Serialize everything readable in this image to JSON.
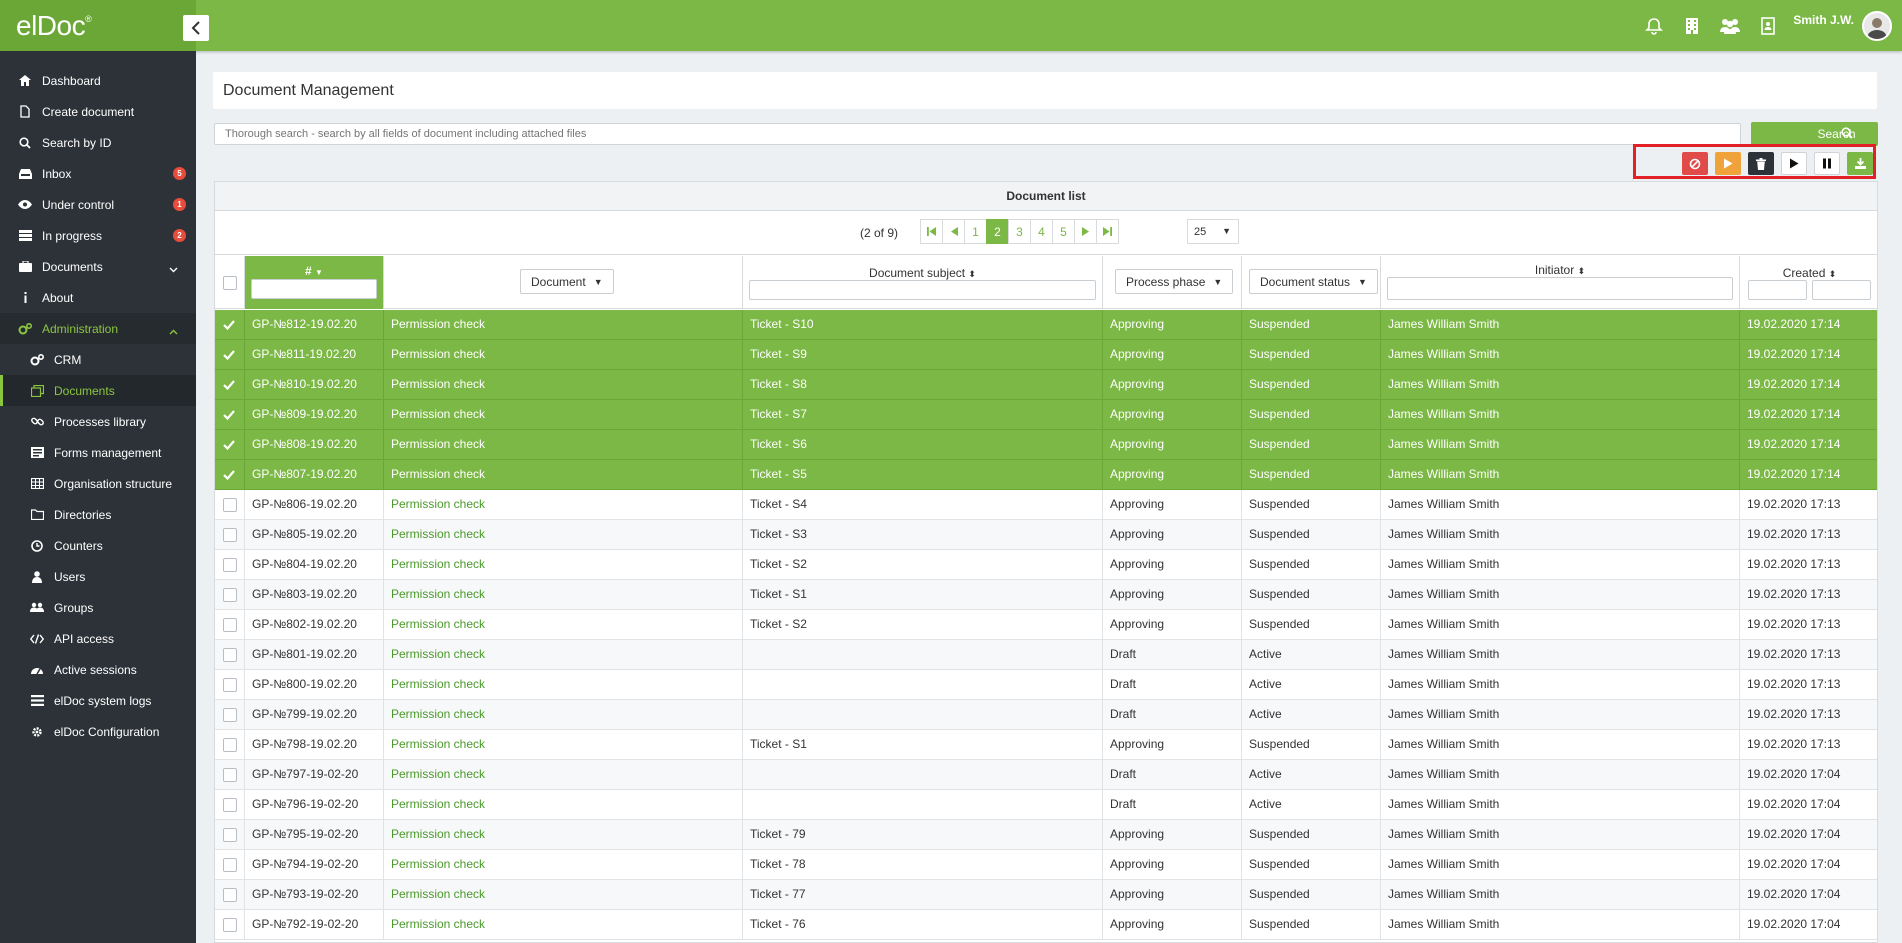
{
  "app": {
    "logo": "elDoc",
    "logo_mark": "®"
  },
  "topbar": {
    "icons": [
      "bell-icon",
      "building-icon",
      "users-icon",
      "book-icon"
    ],
    "user_name": "Smith J.W."
  },
  "sidebar": {
    "items": [
      {
        "label": "Dashboard",
        "icon": "home-icon"
      },
      {
        "label": "Create document",
        "icon": "file-icon"
      },
      {
        "label": "Search by ID",
        "icon": "search-icon"
      },
      {
        "label": "Inbox",
        "icon": "inbox-icon",
        "badge": "5"
      },
      {
        "label": "Under control",
        "icon": "eye-icon",
        "badge": "1"
      },
      {
        "label": "In progress",
        "icon": "progress-icon",
        "badge": "2"
      },
      {
        "label": "Documents",
        "icon": "briefcase-icon"
      },
      {
        "label": "About",
        "icon": "info-icon"
      },
      {
        "label": "Administration",
        "icon": "cogs-icon"
      }
    ],
    "sub_items": [
      {
        "label": "CRM",
        "icon": "cogs-icon"
      },
      {
        "label": "Documents",
        "icon": "documents-icon"
      },
      {
        "label": "Processes library",
        "icon": "link-icon"
      },
      {
        "label": "Forms management",
        "icon": "form-icon"
      },
      {
        "label": "Organisation structure",
        "icon": "table-icon"
      },
      {
        "label": "Directories",
        "icon": "folder-icon"
      },
      {
        "label": "Counters",
        "icon": "clock-icon"
      },
      {
        "label": "Users",
        "icon": "user-icon"
      },
      {
        "label": "Groups",
        "icon": "group-icon"
      },
      {
        "label": "API access",
        "icon": "code-icon"
      },
      {
        "label": "Active sessions",
        "icon": "dashboard-icon"
      },
      {
        "label": "elDoc system logs",
        "icon": "list-icon"
      },
      {
        "label": "elDoc Configuration",
        "icon": "gear-icon"
      }
    ]
  },
  "page": {
    "title": "Document Management",
    "search_placeholder": "Thorough search - search by all fields of document including attached files",
    "search_button": "Search"
  },
  "actions": [
    {
      "name": "cancel-button",
      "icon": "ban-icon",
      "color": "#e04b4a"
    },
    {
      "name": "play-orange-button",
      "icon": "play-icon",
      "color": "#f0a33a"
    },
    {
      "name": "delete-button",
      "icon": "trash-icon",
      "color": "#2c3238"
    },
    {
      "name": "resume-button",
      "icon": "play-icon",
      "color": "#ffffff"
    },
    {
      "name": "suspend-button",
      "icon": "pause-icon",
      "color": "#ffffff"
    },
    {
      "name": "download-button",
      "icon": "download-icon",
      "color": "#7cb845"
    }
  ],
  "table": {
    "title": "Document list",
    "pager_info": "(2 of 9)",
    "pages": [
      "1",
      "2",
      "3",
      "4",
      "5"
    ],
    "current_page": "2",
    "page_size": "25",
    "columns": {
      "number": "#",
      "document": "Document",
      "subject": "Document subject",
      "phase": "Process phase",
      "status": "Document status",
      "initiator": "Initiator",
      "created": "Created"
    },
    "rows": [
      {
        "num": "GP-№812-19.02.20",
        "doc": "Permission check",
        "subject": "Ticket - S10",
        "phase": "Approving",
        "status": "Suspended",
        "initiator": "James William Smith",
        "created": "19.02.2020 17:14",
        "selected": true
      },
      {
        "num": "GP-№811-19.02.20",
        "doc": "Permission check",
        "subject": "Ticket - S9",
        "phase": "Approving",
        "status": "Suspended",
        "initiator": "James William Smith",
        "created": "19.02.2020 17:14",
        "selected": true
      },
      {
        "num": "GP-№810-19.02.20",
        "doc": "Permission check",
        "subject": "Ticket - S8",
        "phase": "Approving",
        "status": "Suspended",
        "initiator": "James William Smith",
        "created": "19.02.2020 17:14",
        "selected": true
      },
      {
        "num": "GP-№809-19.02.20",
        "doc": "Permission check",
        "subject": "Ticket - S7",
        "phase": "Approving",
        "status": "Suspended",
        "initiator": "James William Smith",
        "created": "19.02.2020 17:14",
        "selected": true
      },
      {
        "num": "GP-№808-19.02.20",
        "doc": "Permission check",
        "subject": "Ticket - S6",
        "phase": "Approving",
        "status": "Suspended",
        "initiator": "James William Smith",
        "created": "19.02.2020 17:14",
        "selected": true
      },
      {
        "num": "GP-№807-19.02.20",
        "doc": "Permission check",
        "subject": "Ticket - S5",
        "phase": "Approving",
        "status": "Suspended",
        "initiator": "James William Smith",
        "created": "19.02.2020 17:14",
        "selected": true
      },
      {
        "num": "GP-№806-19.02.20",
        "doc": "Permission check",
        "subject": "Ticket - S4",
        "phase": "Approving",
        "status": "Suspended",
        "initiator": "James William Smith",
        "created": "19.02.2020 17:13",
        "selected": false
      },
      {
        "num": "GP-№805-19.02.20",
        "doc": "Permission check",
        "subject": "Ticket - S3",
        "phase": "Approving",
        "status": "Suspended",
        "initiator": "James William Smith",
        "created": "19.02.2020 17:13",
        "selected": false
      },
      {
        "num": "GP-№804-19.02.20",
        "doc": "Permission check",
        "subject": "Ticket - S2",
        "phase": "Approving",
        "status": "Suspended",
        "initiator": "James William Smith",
        "created": "19.02.2020 17:13",
        "selected": false
      },
      {
        "num": "GP-№803-19.02.20",
        "doc": "Permission check",
        "subject": "Ticket - S1",
        "phase": "Approving",
        "status": "Suspended",
        "initiator": "James William Smith",
        "created": "19.02.2020 17:13",
        "selected": false
      },
      {
        "num": "GP-№802-19.02.20",
        "doc": "Permission check",
        "subject": "Ticket - S2",
        "phase": "Approving",
        "status": "Suspended",
        "initiator": "James William Smith",
        "created": "19.02.2020 17:13",
        "selected": false
      },
      {
        "num": "GP-№801-19.02.20",
        "doc": "Permission check",
        "subject": "",
        "phase": "Draft",
        "status": "Active",
        "initiator": "James William Smith",
        "created": "19.02.2020 17:13",
        "selected": false
      },
      {
        "num": "GP-№800-19.02.20",
        "doc": "Permission check",
        "subject": "",
        "phase": "Draft",
        "status": "Active",
        "initiator": "James William Smith",
        "created": "19.02.2020 17:13",
        "selected": false
      },
      {
        "num": "GP-№799-19.02.20",
        "doc": "Permission check",
        "subject": "",
        "phase": "Draft",
        "status": "Active",
        "initiator": "James William Smith",
        "created": "19.02.2020 17:13",
        "selected": false
      },
      {
        "num": "GP-№798-19.02.20",
        "doc": "Permission check",
        "subject": "Ticket - S1",
        "phase": "Approving",
        "status": "Suspended",
        "initiator": "James William Smith",
        "created": "19.02.2020 17:13",
        "selected": false
      },
      {
        "num": "GP-№797-19-02-20",
        "doc": "Permission check",
        "subject": "",
        "phase": "Draft",
        "status": "Active",
        "initiator": "James William Smith",
        "created": "19.02.2020 17:04",
        "selected": false
      },
      {
        "num": "GP-№796-19-02-20",
        "doc": "Permission check",
        "subject": "",
        "phase": "Draft",
        "status": "Active",
        "initiator": "James William Smith",
        "created": "19.02.2020 17:04",
        "selected": false
      },
      {
        "num": "GP-№795-19-02-20",
        "doc": "Permission check",
        "subject": "Ticket - 79",
        "phase": "Approving",
        "status": "Suspended",
        "initiator": "James William Smith",
        "created": "19.02.2020 17:04",
        "selected": false
      },
      {
        "num": "GP-№794-19-02-20",
        "doc": "Permission check",
        "subject": "Ticket - 78",
        "phase": "Approving",
        "status": "Suspended",
        "initiator": "James William Smith",
        "created": "19.02.2020 17:04",
        "selected": false
      },
      {
        "num": "GP-№793-19-02-20",
        "doc": "Permission check",
        "subject": "Ticket - 77",
        "phase": "Approving",
        "status": "Suspended",
        "initiator": "James William Smith",
        "created": "19.02.2020 17:04",
        "selected": false
      },
      {
        "num": "GP-№792-19-02-20",
        "doc": "Permission check",
        "subject": "Ticket - 76",
        "phase": "Approving",
        "status": "Suspended",
        "initiator": "James William Smith",
        "created": "19.02.2020 17:04",
        "selected": false
      }
    ]
  }
}
